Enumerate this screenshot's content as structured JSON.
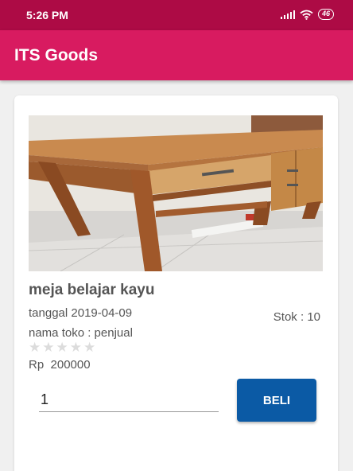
{
  "status_bar": {
    "time": "5:26 PM",
    "battery": "46",
    "icons": [
      "signal-icon",
      "wifi-icon",
      "battery-icon"
    ]
  },
  "app_bar": {
    "title": "ITS Goods"
  },
  "product": {
    "name": "meja belajar kayu",
    "date": "tanggal 2019-04-09",
    "stock": "Stok : 10",
    "shop": "nama toko : penjual",
    "rating": 0,
    "rating_max": 5,
    "price": "Rp  200000",
    "image_alt": "wooden desk photo"
  },
  "purchase": {
    "quantity": "1",
    "buy_label": "BELI"
  },
  "colors": {
    "status_bar": "#ad0b45",
    "app_bar": "#d81b60",
    "button": "#0b5aa5"
  }
}
